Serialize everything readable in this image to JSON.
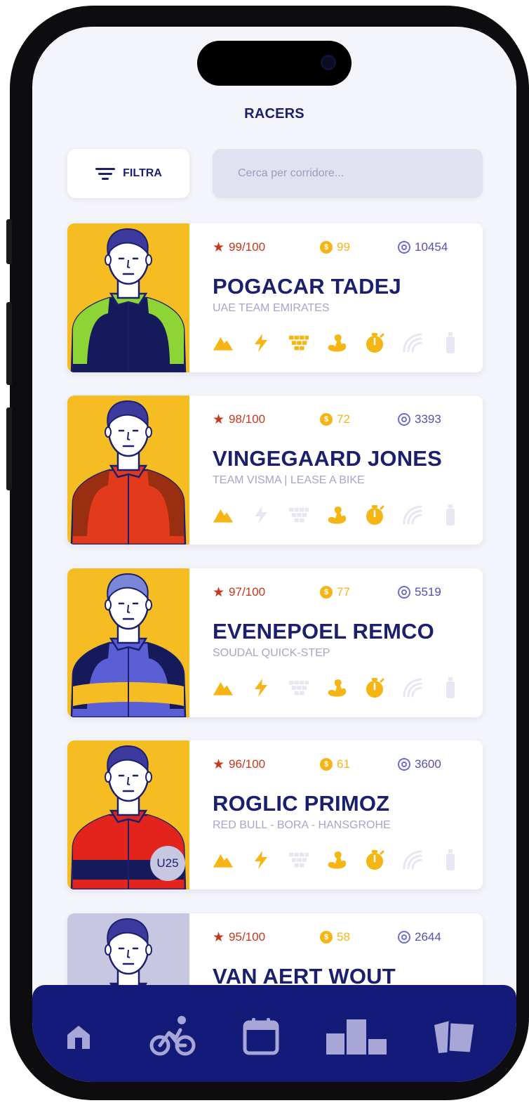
{
  "header": {
    "title": "RACERS"
  },
  "toolbar": {
    "filter_label": "FILTRA",
    "search_placeholder": "Cerca per corridore..."
  },
  "colors": {
    "accent": "#1a1f6e",
    "gold": "#f5b514",
    "rating": "#c8361c",
    "points": "#5350b3",
    "nav_bg": "#141a77"
  },
  "skill_icons": [
    "mountain-icon",
    "lightning-icon",
    "cobbles-icon",
    "muscle-icon",
    "stopwatch-icon",
    "wind-icon",
    "bottle-icon"
  ],
  "racers": [
    {
      "rating": "99/100",
      "price": "99",
      "points": "10454",
      "name": "POGACAR TADEJ",
      "team": "UAE TEAM EMIRATES",
      "skills_active": [
        true,
        true,
        true,
        true,
        true,
        false,
        false
      ],
      "badge": ""
    },
    {
      "rating": "98/100",
      "price": "72",
      "points": "3393",
      "name": "VINGEGAARD JONES",
      "team": "TEAM VISMA | LEASE A BIKE",
      "skills_active": [
        true,
        false,
        false,
        true,
        true,
        false,
        false
      ],
      "badge": ""
    },
    {
      "rating": "97/100",
      "price": "77",
      "points": "5519",
      "name": "EVENEPOEL REMCO",
      "team": "SOUDAL QUICK-STEP",
      "skills_active": [
        true,
        true,
        false,
        true,
        true,
        false,
        false
      ],
      "badge": ""
    },
    {
      "rating": "96/100",
      "price": "61",
      "points": "3600",
      "name": "ROGLIC PRIMOZ",
      "team": "RED BULL - BORA - HANSGROHE",
      "skills_active": [
        true,
        true,
        false,
        true,
        true,
        false,
        false
      ],
      "badge": "U25"
    },
    {
      "rating": "95/100",
      "price": "58",
      "points": "2644",
      "name": "VAN AERT WOUT",
      "team": "",
      "skills_active": [],
      "badge": ""
    }
  ],
  "nav": [
    "home-icon",
    "cyclist-icon",
    "calendar-icon",
    "podium-icon",
    "cards-icon"
  ]
}
